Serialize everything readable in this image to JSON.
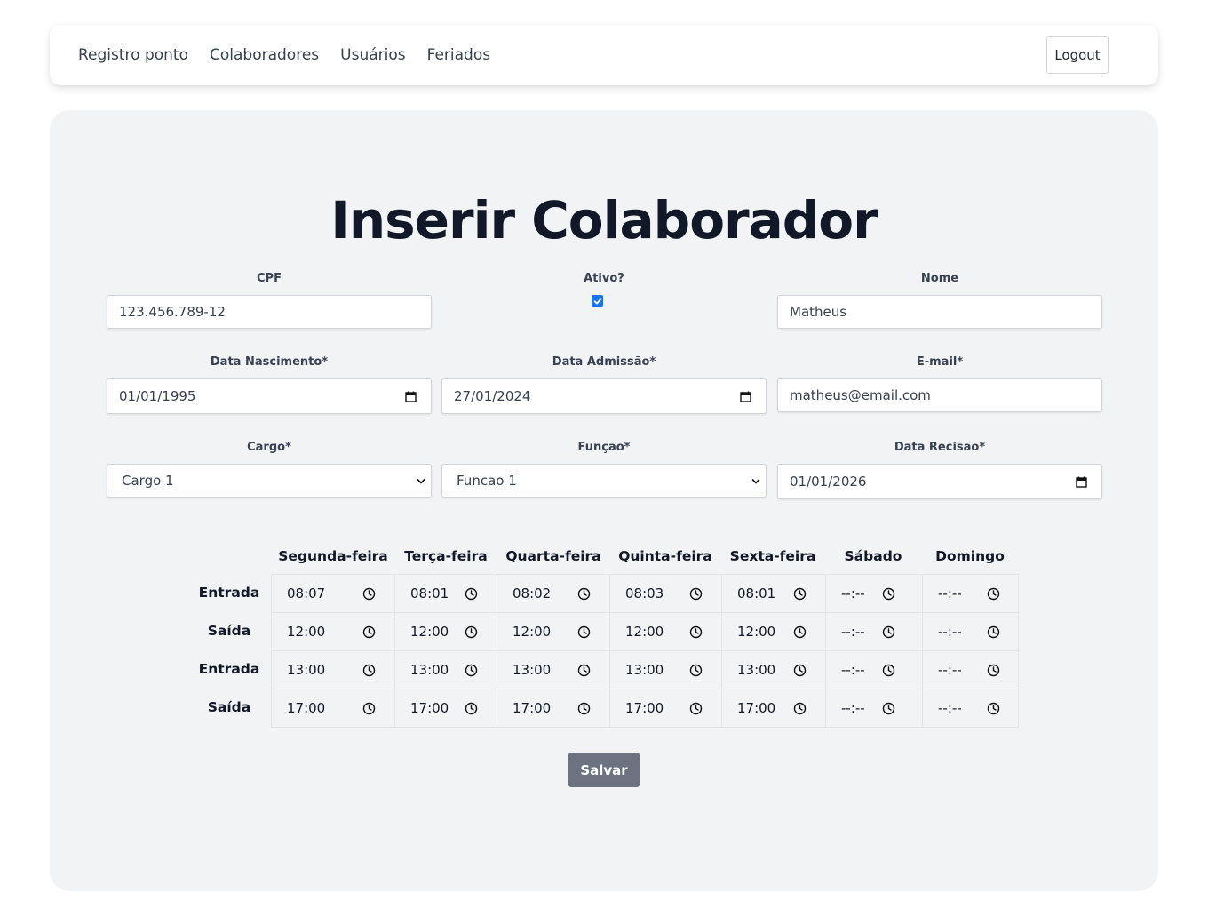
{
  "nav": {
    "links": [
      "Registro ponto",
      "Colaboradores",
      "Usuários",
      "Feriados"
    ],
    "logout_label": "Logout"
  },
  "form": {
    "title": "Inserir Colaborador",
    "cpf": {
      "label": "CPF",
      "value": "123.456.789-12"
    },
    "ativo": {
      "label": "Ativo?",
      "checked": true
    },
    "nome": {
      "label": "Nome",
      "value": "Matheus"
    },
    "data_nascimento": {
      "label": "Data Nascimento*",
      "value": "01/01/1995"
    },
    "data_admissao": {
      "label": "Data Admissão*",
      "value": "27/01/2024"
    },
    "email": {
      "label": "E-mail*",
      "value": "matheus@email.com"
    },
    "cargo": {
      "label": "Cargo*",
      "value": "Cargo 1"
    },
    "funcao": {
      "label": "Função*",
      "value": "Funcao 1"
    },
    "data_recisao": {
      "label": "Data Recisão*",
      "value": "01/01/2026"
    }
  },
  "schedule": {
    "days": [
      "Segunda-feira",
      "Terça-feira",
      "Quarta-feira",
      "Quinta-feira",
      "Sexta-feira",
      "Sábado",
      "Domingo"
    ],
    "row_labels": [
      "Entrada",
      "Saída",
      "Entrada",
      "Saída"
    ],
    "times": [
      [
        "08:07",
        "08:01",
        "08:02",
        "08:03",
        "08:01",
        "--:--",
        "--:--"
      ],
      [
        "12:00",
        "12:00",
        "12:00",
        "12:00",
        "12:00",
        "--:--",
        "--:--"
      ],
      [
        "13:00",
        "13:00",
        "13:00",
        "13:00",
        "13:00",
        "--:--",
        "--:--"
      ],
      [
        "17:00",
        "17:00",
        "17:00",
        "17:00",
        "17:00",
        "--:--",
        "--:--"
      ]
    ],
    "icons": {
      "time": "clock-icon",
      "date": "calendar-icon",
      "select": "chevron-down-icon"
    }
  },
  "actions": {
    "save_label": "Salvar"
  }
}
